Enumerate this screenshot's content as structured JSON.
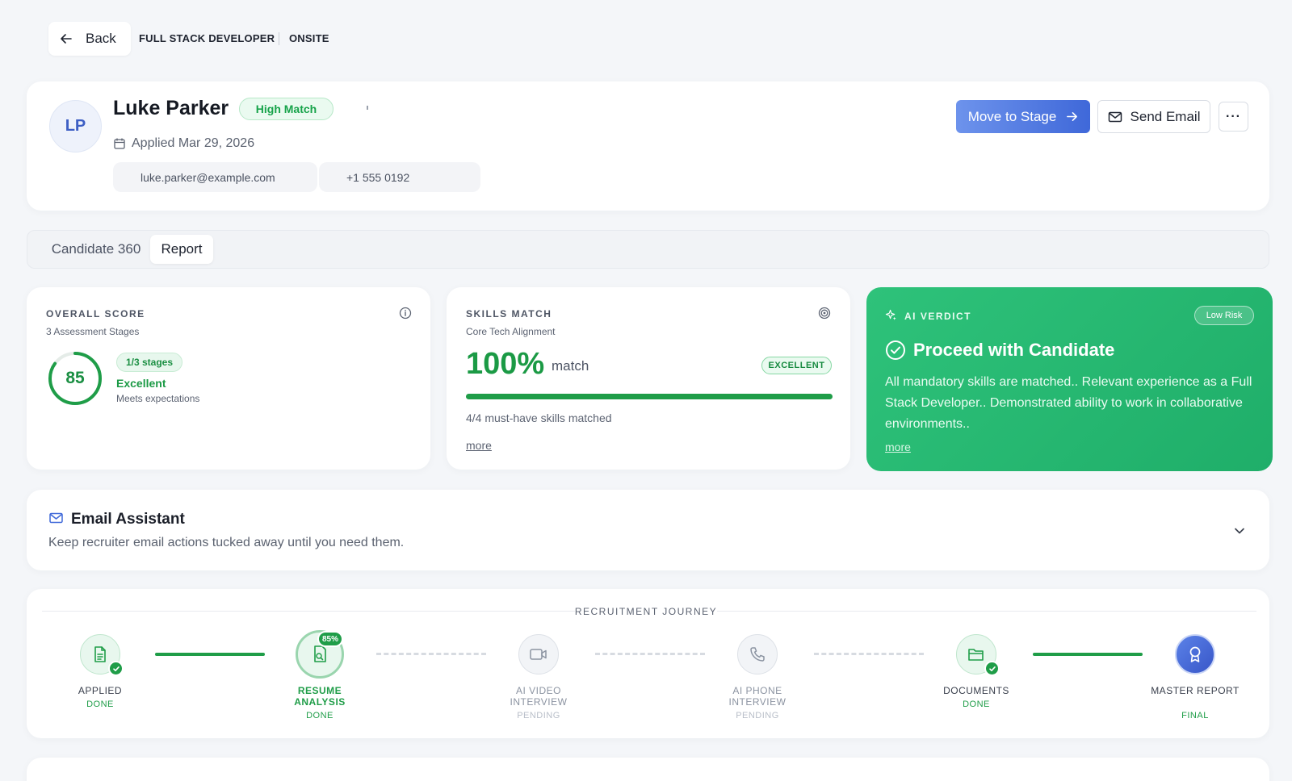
{
  "topbar": {
    "back_label": "Back",
    "job_title": "FULL STACK DEVELOPER",
    "stage": "ONSITE"
  },
  "candidate": {
    "initials": "LP",
    "name": "Luke Parker",
    "match_badge": "High Match",
    "applied": "Applied Mar 29, 2026",
    "email": "luke.parker@example.com",
    "phone": "+1 555 0192"
  },
  "actions": {
    "move_label": "Move to Stage",
    "email_label": "Send Email",
    "more_label": "···"
  },
  "tabs": [
    {
      "label": "Candidate 360",
      "active": false
    },
    {
      "label": "Report",
      "active": true
    }
  ],
  "overall_score": {
    "title": "OVERALL SCORE",
    "subtitle": "3 Assessment Stages",
    "score": "85",
    "score_value": 85,
    "stages_pill": "1/3 stages",
    "rating": "Excellent",
    "rating_note": "Meets expectations"
  },
  "skills_match": {
    "title": "SKILLS MATCH",
    "subtitle": "Core Tech Alignment",
    "percent": "100%",
    "percent_value": 100,
    "match_word": "match",
    "badge": "EXCELLENT",
    "summary": "4/4 must-have skills matched",
    "more": "more"
  },
  "ai_verdict": {
    "title": "AI VERDICT",
    "risk": "Low Risk",
    "headline": "Proceed with Candidate",
    "text": "All mandatory skills are matched.. Relevant experience as a Full Stack Developer.. Demonstrated ability to work in collaborative environments..",
    "more": "more"
  },
  "email_assistant": {
    "title": "Email Assistant",
    "subtitle": "Keep recruiter email actions tucked away until you need them."
  },
  "journey": {
    "title": "RECRUITMENT JOURNEY",
    "steps": [
      {
        "label": "APPLIED",
        "status": "DONE",
        "state": "done",
        "icon": "document-icon"
      },
      {
        "label": "RESUME ANALYSIS",
        "status": "DONE",
        "state": "active",
        "icon": "resume-search-icon",
        "badge": "85%"
      },
      {
        "label": "AI VIDEO INTERVIEW",
        "status": "PENDING",
        "state": "pending",
        "icon": "video-icon"
      },
      {
        "label": "AI PHONE INTERVIEW",
        "status": "PENDING",
        "state": "pending",
        "icon": "phone-icon"
      },
      {
        "label": "DOCUMENTS",
        "status": "DONE",
        "state": "done",
        "icon": "folder-icon"
      },
      {
        "label": "MASTER REPORT",
        "status": "FINAL",
        "state": "final",
        "icon": "award-icon"
      }
    ]
  },
  "colors": {
    "accent_green": "#1f9d48",
    "accent_blue": "#3f68d9",
    "verdict_bg": "#24b872"
  }
}
